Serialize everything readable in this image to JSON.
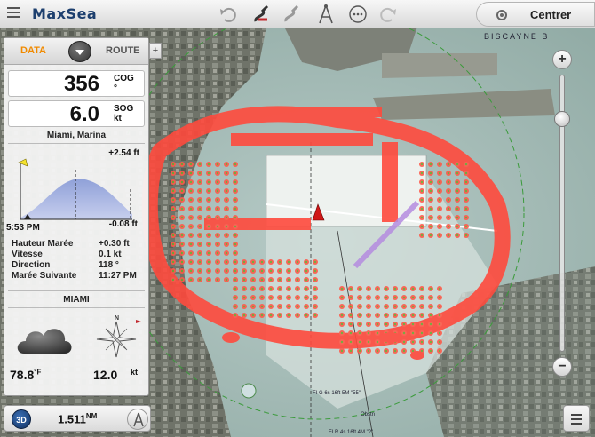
{
  "app": {
    "brand": "MaxSea",
    "centrer_label": "Centrer"
  },
  "toolbar": {
    "icons": [
      "menu-icon",
      "undo-icon",
      "route-icon",
      "track-icon",
      "compass-icon",
      "more-icon",
      "redo-icon"
    ]
  },
  "panel": {
    "tabs": {
      "data": "DATA",
      "route": "ROUTE"
    },
    "add_tab": "+",
    "cog": {
      "value": "356",
      "unit": "COG",
      "sub": "°"
    },
    "sog": {
      "value": "6.0",
      "unit": "SOG",
      "sub": "kt"
    },
    "tide": {
      "station": "Miami, Marina",
      "max": "+2.54 ft",
      "min": "-0.08 ft",
      "time": "5:53 PM",
      "rows": [
        {
          "label": "Hauteur Marée",
          "value": "+0.30 ft"
        },
        {
          "label": "Vitesse",
          "value": "0.1 kt"
        },
        {
          "label": "Direction",
          "value": "118 °"
        },
        {
          "label": "Marée Suivante",
          "value": "11:27 PM"
        }
      ]
    },
    "weather": {
      "station": "MIAMI",
      "temp": "78.8",
      "temp_unit": "°F",
      "wind": "12.0",
      "wind_unit": "kt",
      "compass_north": "N"
    }
  },
  "bottom": {
    "mode_3d": "3D",
    "distance": "1.511",
    "distance_unit": "NM"
  },
  "zoom": {
    "plus": "+",
    "minus": "−",
    "level": 0.84
  },
  "map": {
    "labels": [
      "BISCAYNE B",
      "FI G 6s 16ft 5M \"55\"",
      "Obstn",
      "FI R 4s 16ft 4M \"2\""
    ]
  },
  "colors": {
    "accent": "#f08a00",
    "overlay": "#ff4a3d",
    "brand": "#1d3f6e"
  }
}
